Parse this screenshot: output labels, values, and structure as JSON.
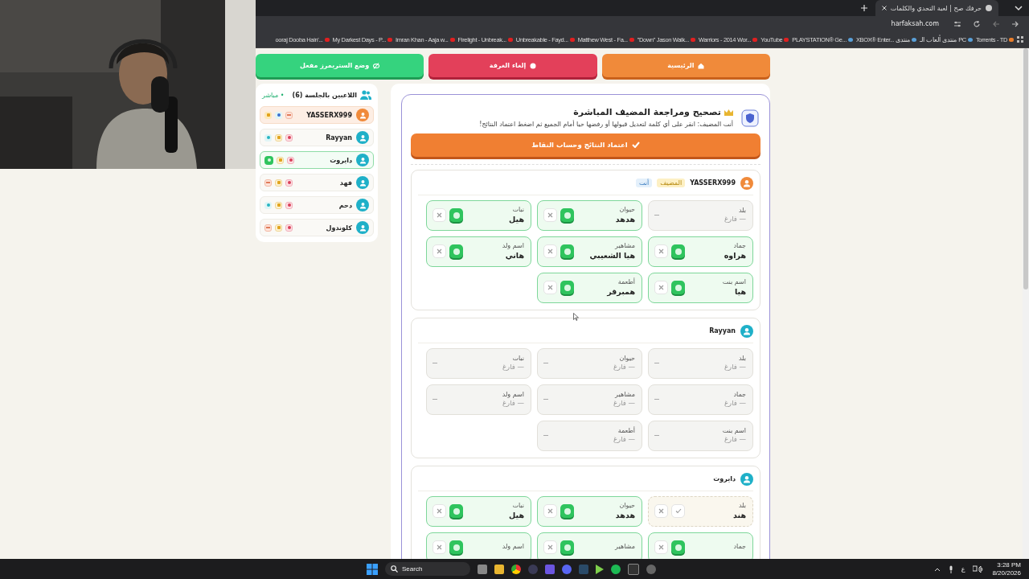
{
  "browser": {
    "tab_title": "حرفك صح | لعبة التحدي والكلمات",
    "address": "harfaksah.com",
    "bookmarks": [
      {
        "label": "Torrents - TD",
        "kind": "torrent"
      },
      {
        "label": "منتدى ألعاب الـ PC",
        "kind": "site"
      },
      {
        "label": "XBOX® Enter... منتدى",
        "kind": "site"
      },
      {
        "label": "PLAYSTATION® Ge...",
        "kind": "site"
      },
      {
        "label": "YouTube",
        "kind": "video"
      },
      {
        "label": "Warriors - 2014 Wor...",
        "kind": "video"
      },
      {
        "label": "\"Down\" Jason Walk...",
        "kind": "video"
      },
      {
        "label": "Matthew West - Fa...",
        "kind": "video"
      },
      {
        "label": "Unbreakable - Fayd...",
        "kind": "video"
      },
      {
        "label": "Firelight - Unbreak...",
        "kind": "video"
      },
      {
        "label": "Imran Khan - Aaja w...",
        "kind": "video"
      },
      {
        "label": "My Darkest Days - P...",
        "kind": "video"
      },
      {
        "label": "ooraj Dooba Hain'...",
        "kind": "video"
      }
    ]
  },
  "top_buttons": [
    {
      "label": "الرئيسية",
      "kind": "home"
    },
    {
      "label": "إلغاء الغرفة",
      "kind": "cancel"
    },
    {
      "label": "وضع الستريمرز مفعل",
      "kind": "stream"
    }
  ],
  "review": {
    "title": "تصحيح ومراجعة المضيف المباشرة",
    "subtitle": "أنت المضيف: انقر على أي كلمة لتعديل قبولها أو رفضها حيا أمام الجميع ثم اضغط اعتماد النتائج!",
    "approve_button": "اعتماد النتائج وحساب النقاط",
    "players": [
      {
        "name": "YASSERX999",
        "host": true,
        "tags": [
          {
            "label": "المضيف",
            "kind": "host"
          },
          {
            "label": "أنت",
            "kind": "you"
          }
        ],
        "cells": [
          {
            "category": "بلد",
            "kind": "empty",
            "answer": "— فارغ"
          },
          {
            "category": "حيوان",
            "kind": "accepted",
            "answer": "هدهد"
          },
          {
            "category": "نبات",
            "kind": "accepted",
            "answer": "هيل"
          },
          {
            "category": "جماد",
            "kind": "accepted",
            "answer": "هراوه"
          },
          {
            "category": "مشاهير",
            "kind": "accepted",
            "answer": "هيا الشعيبي"
          },
          {
            "category": "اسم ولد",
            "kind": "accepted",
            "answer": "هاني"
          },
          {
            "category": "اسم بنت",
            "kind": "accepted",
            "answer": "هيا"
          },
          {
            "category": "أطعمة",
            "kind": "accepted",
            "answer": "همبرقر"
          }
        ]
      },
      {
        "name": "Rayyan",
        "host": false,
        "cells": [
          {
            "category": "بلد",
            "kind": "empty",
            "answer": "— فارغ"
          },
          {
            "category": "حيوان",
            "kind": "empty",
            "answer": "— فارغ"
          },
          {
            "category": "نبات",
            "kind": "empty",
            "answer": "— فارغ"
          },
          {
            "category": "جماد",
            "kind": "empty",
            "answer": "— فارغ"
          },
          {
            "category": "مشاهير",
            "kind": "empty",
            "answer": "— فارغ"
          },
          {
            "category": "اسم ولد",
            "kind": "empty",
            "answer": "— فارغ"
          },
          {
            "category": "اسم بنت",
            "kind": "empty",
            "answer": "— فارغ"
          },
          {
            "category": "أطعمة",
            "kind": "empty",
            "answer": "— فارغ"
          }
        ]
      },
      {
        "name": "دايروت",
        "host": false,
        "cells": [
          {
            "category": "بلد",
            "kind": "pending",
            "answer": "هند"
          },
          {
            "category": "حيوان",
            "kind": "accepted",
            "answer": "هدهد"
          },
          {
            "category": "نبات",
            "kind": "accepted",
            "answer": "هيل"
          },
          {
            "category": "جماد",
            "kind": "accepted"
          },
          {
            "category": "مشاهير",
            "kind": "accepted"
          },
          {
            "category": "اسم ولد",
            "kind": "accepted"
          }
        ]
      }
    ]
  },
  "sidebar": {
    "title": "اللاعبين بالجلسة (6)",
    "live": "• مباشر",
    "players": [
      {
        "name": "YASSERX999",
        "kind": "host",
        "host": true,
        "badges": [
          {
            "kind": "edit"
          },
          {
            "kind": "dot"
          },
          {
            "kind": "box"
          }
        ]
      },
      {
        "name": "Rayyan",
        "kind": "normal",
        "host": false,
        "badges": [
          {
            "kind": "kick"
          },
          {
            "kind": "crown"
          },
          {
            "kind": "dot"
          }
        ]
      },
      {
        "name": "دايروت",
        "kind": "done",
        "host": false,
        "badges": [
          {
            "kind": "kick"
          },
          {
            "kind": "crown"
          },
          {
            "kind": "check"
          }
        ]
      },
      {
        "name": "فهد",
        "kind": "normal",
        "host": false,
        "badges": [
          {
            "kind": "kick"
          },
          {
            "kind": "crown"
          },
          {
            "kind": "edit"
          }
        ]
      },
      {
        "name": "دحم",
        "kind": "normal",
        "host": false,
        "badges": [
          {
            "kind": "kick"
          },
          {
            "kind": "crown"
          },
          {
            "kind": "dot"
          }
        ]
      },
      {
        "name": "كلوندول",
        "kind": "normal",
        "host": false,
        "badges": [
          {
            "kind": "kick"
          },
          {
            "kind": "crown"
          },
          {
            "kind": "edit"
          }
        ]
      }
    ]
  },
  "taskbar": {
    "search": "Search",
    "language": "ع",
    "time": "3:28 PM",
    "date": "8/20/2026"
  }
}
